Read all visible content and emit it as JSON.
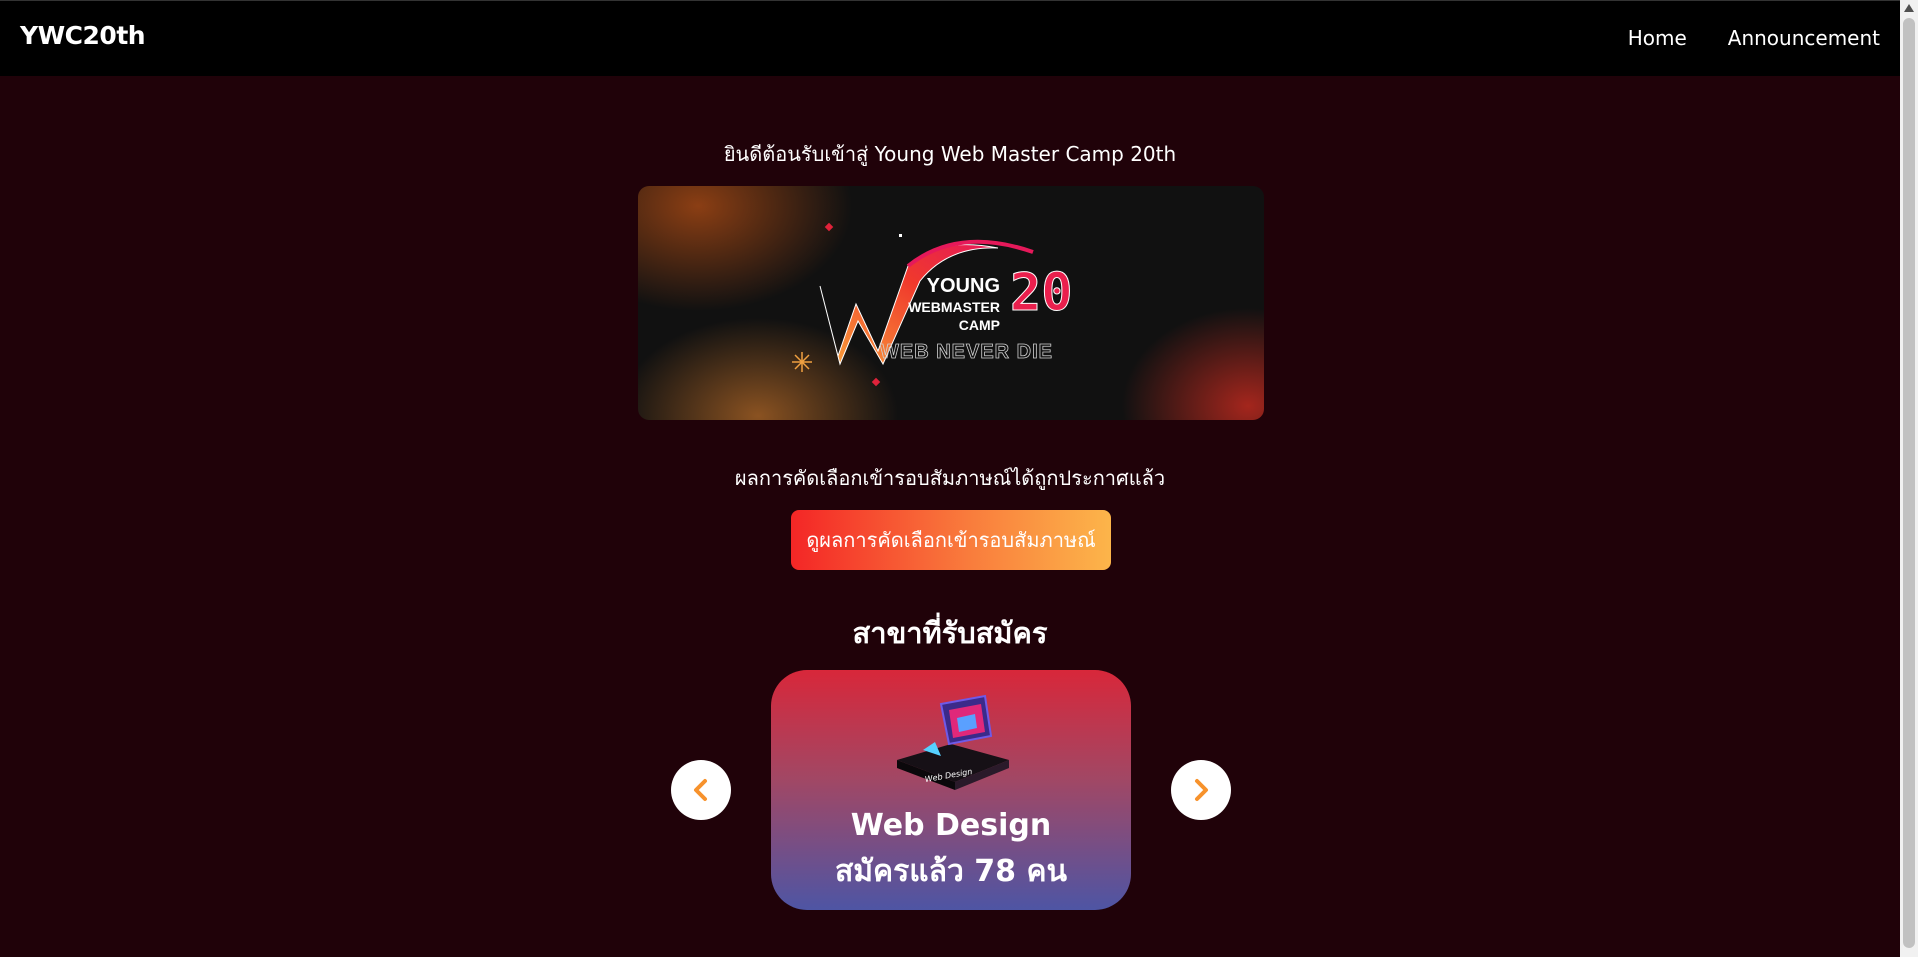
{
  "navbar": {
    "brand": "YWC20th",
    "links": [
      "Home",
      "Announcement"
    ]
  },
  "hero": {
    "welcome_text": "ยินดีต้อนรับเข้าสู่ Young Web Master Camp 20th",
    "banner": {
      "logo_lines": [
        "YOUNG",
        "WEBMASTER",
        "CAMP"
      ],
      "logo_number": "20",
      "tagline": "WEB NEVER DIE"
    }
  },
  "announcement": {
    "text": "ผลการคัดเลือกเข้ารอบสัมภาษณ์ได้ถูกประกาศแล้ว",
    "button_label": "ดูผลการคัดเลือกเข้ารอบสัมภาษณ์"
  },
  "majors": {
    "title": "สาขาที่รับสมัคร",
    "card": {
      "name": "Web Design",
      "count_text": "สมัครแล้ว 78 คน",
      "illustration_label": "Web Design"
    }
  },
  "colors": {
    "background": "#200209",
    "navbar": "#000000",
    "button_gradient": [
      "#f42626",
      "#fcb54a"
    ],
    "card_gradient": [
      "#d8273a",
      "#4e55a4"
    ],
    "arrow_accent": "#f7922c"
  },
  "icons": {
    "prev": "chevron-left-icon",
    "next": "chevron-right-icon"
  }
}
